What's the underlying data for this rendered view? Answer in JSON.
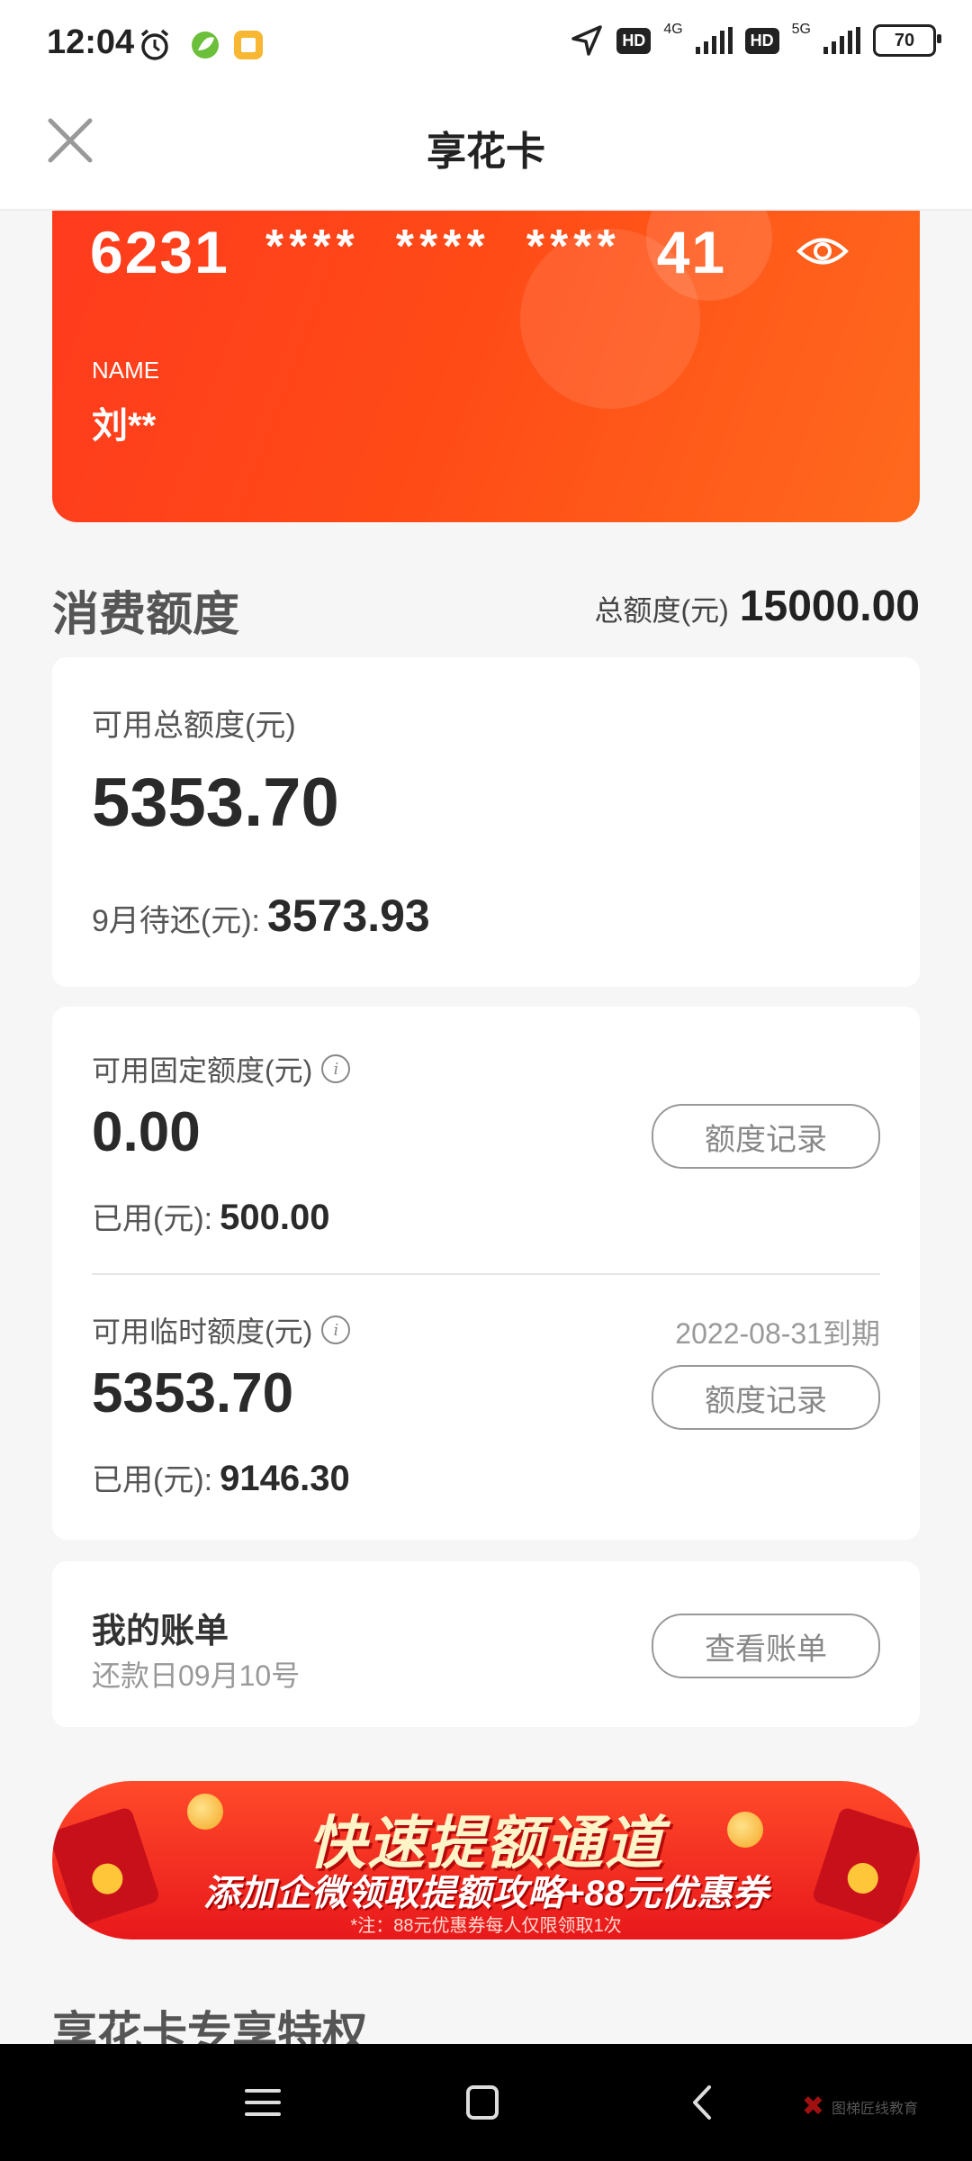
{
  "status_bar": {
    "time": "12:04",
    "hd1": "HD",
    "net1": "4G",
    "hd2": "HD",
    "net2": "5G",
    "battery": "70"
  },
  "nav": {
    "title": "享花卡",
    "close_icon": "close-icon"
  },
  "card": {
    "number_start": "6231",
    "mask1": "****",
    "mask2": "****",
    "mask3": "****",
    "number_end": "41",
    "name_label": "NAME",
    "name": "刘**",
    "gradient_colors": [
      "#ff3b1e",
      "#ff6a1e"
    ]
  },
  "quota": {
    "title": "消费额度",
    "total_label": "总额度(元)",
    "total_value": "15000.00"
  },
  "available": {
    "label": "可用总额度(元)",
    "value": "5353.70",
    "due_label": "9月待还(元):",
    "due_value": "3573.93"
  },
  "fixed": {
    "label": "可用固定额度(元)",
    "value": "0.00",
    "used_label": "已用(元):",
    "used_value": "500.00",
    "button": "额度记录"
  },
  "temporary": {
    "label": "可用临时额度(元)",
    "expire": "2022-08-31到期",
    "value": "5353.70",
    "used_label": "已用(元):",
    "used_value": "9146.30",
    "button": "额度记录"
  },
  "bill": {
    "title": "我的账单",
    "subtitle": "还款日09月10号",
    "button": "查看账单"
  },
  "banner": {
    "title": "快速提额通道",
    "subtitle": "添加企微领取提额攻略+88元优惠券",
    "note": "*注：88元优惠券每人仅限领取1次"
  },
  "section_peek": "享花卡专享特权",
  "system_nav": {
    "watermark": "图梯匠线教育"
  },
  "colors": {
    "accent": "#ff4a16",
    "banner": "#e8181b"
  }
}
